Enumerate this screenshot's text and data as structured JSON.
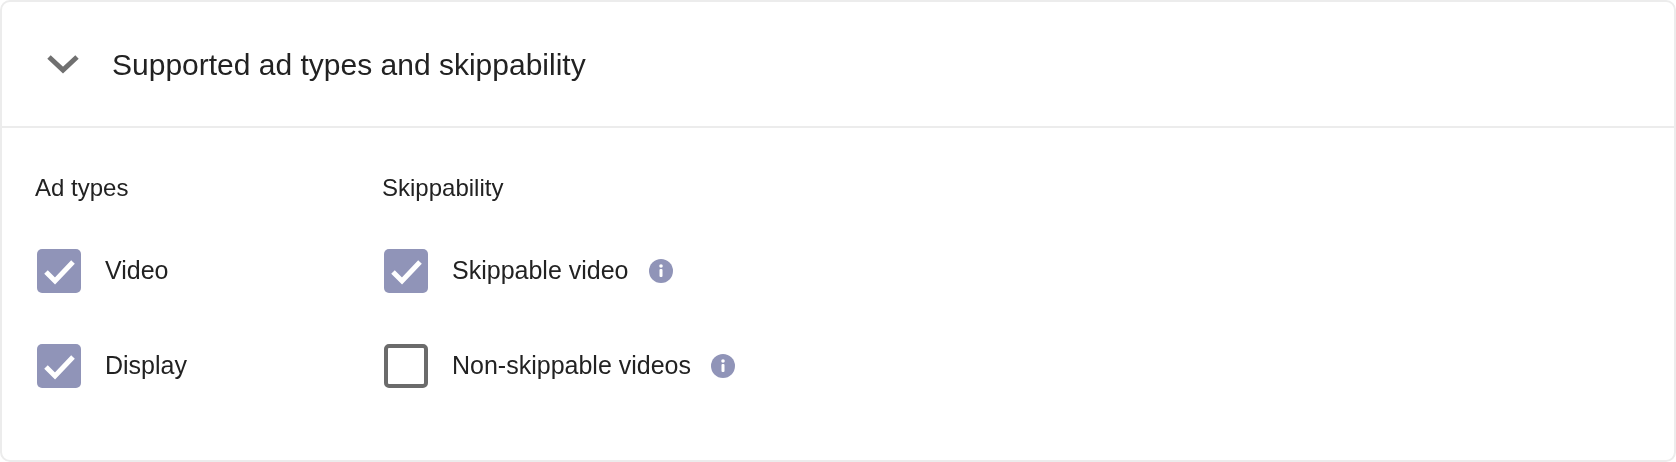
{
  "section": {
    "title": "Supported ad types and skippability",
    "expanded": true
  },
  "groups": [
    {
      "heading": "Ad types",
      "options": [
        {
          "label": "Video",
          "checked": true,
          "info": false
        },
        {
          "label": "Display",
          "checked": true,
          "info": false
        }
      ]
    },
    {
      "heading": "Skippability",
      "options": [
        {
          "label": "Skippable video",
          "checked": true,
          "info": true
        },
        {
          "label": "Non-skippable videos",
          "checked": false,
          "info": true
        }
      ]
    }
  ]
}
